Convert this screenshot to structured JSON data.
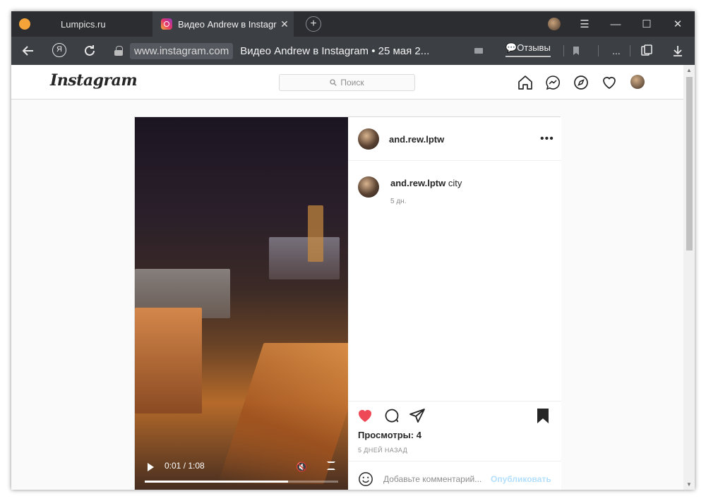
{
  "browser": {
    "tabs": [
      {
        "label": "Lumpics.ru",
        "active": false
      },
      {
        "label": "Видео Andrew в Instagram",
        "active": true
      }
    ],
    "new_tab_label": "+",
    "close_tab": "✕",
    "controls": {
      "menu": "☰",
      "minimize": "—",
      "maximize": "☐",
      "close": "✕"
    },
    "address": {
      "domain": "www.instagram.com",
      "title": "Видео Andrew в Instagram • 25 мая 2..."
    },
    "reviews_label": "Отзывы",
    "more_label": "..."
  },
  "instagram": {
    "logo": "Instagram",
    "search_placeholder": "Поиск",
    "post": {
      "username": "and.rew.lptw",
      "caption_user": "and.rew.lptw",
      "caption_text": "city",
      "caption_age": "5 дн.",
      "video_time": "0:01 / 1:08",
      "video_progress": 0.74,
      "liked": true,
      "saved": true,
      "views": "Просмотры: 4",
      "date": "5 ДНЕЙ НАЗАД",
      "comment_placeholder": "Добавьте комментарий...",
      "publish_label": "Опубликовать"
    }
  },
  "colors": {
    "like": "#ed4956",
    "publish": "#b2dffc",
    "tab_bar": "#2b2d31",
    "address_bar": "#3c3f44"
  }
}
